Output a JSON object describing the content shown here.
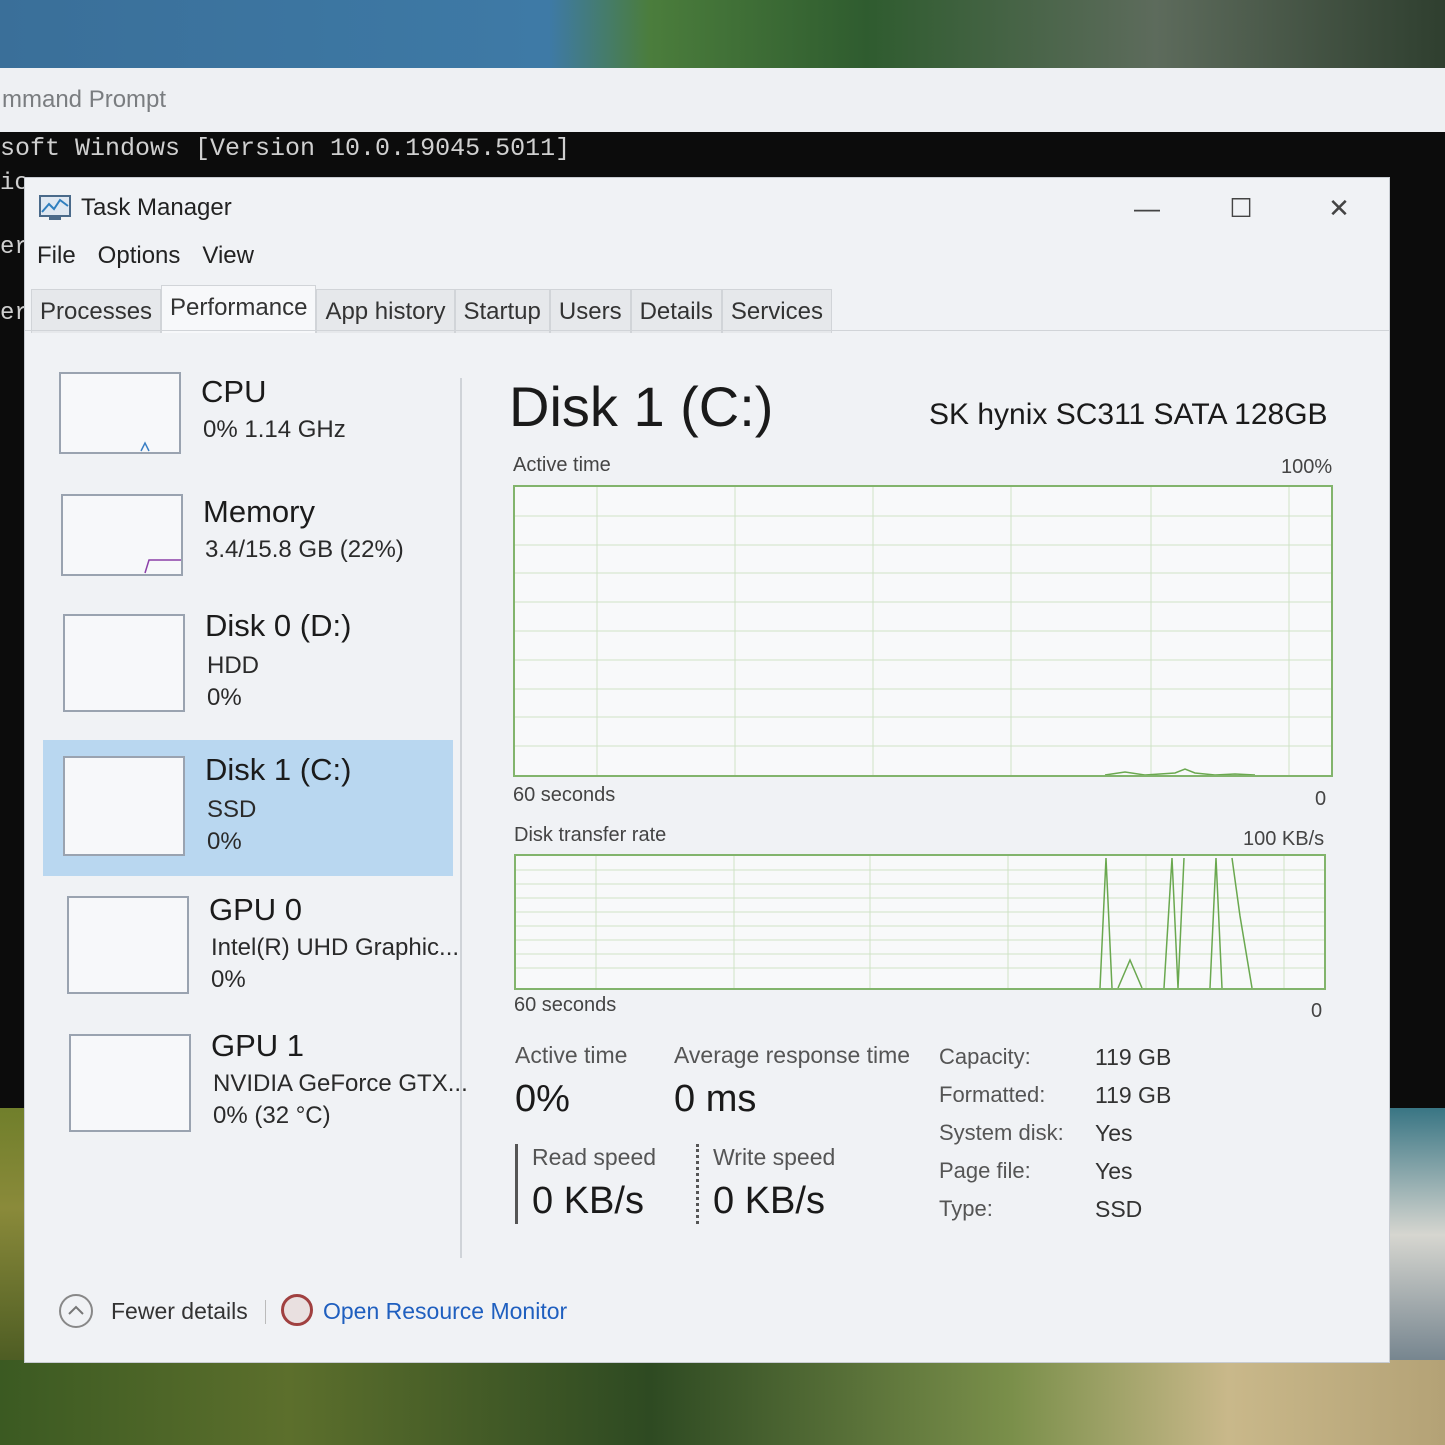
{
  "cmd": {
    "title": "mmand Prompt",
    "line1": "soft Windows [Version 10.0.19045.5011]",
    "frag1": "ic",
    "frag2": "er",
    "frag3": "er"
  },
  "window": {
    "title": "Task Manager",
    "minimize": "—",
    "maximize": "☐",
    "close": "✕"
  },
  "menu": [
    "File",
    "Options",
    "View"
  ],
  "tabs": [
    "Processes",
    "Performance",
    "App history",
    "Startup",
    "Users",
    "Details",
    "Services"
  ],
  "active_tab": "Performance",
  "sidebar": [
    {
      "name": "CPU",
      "sub1": "0%  1.14 GHz",
      "sub2": "",
      "sub3": ""
    },
    {
      "name": "Memory",
      "sub1": "3.4/15.8 GB (22%)",
      "sub2": "",
      "sub3": ""
    },
    {
      "name": "Disk 0 (D:)",
      "sub1": "HDD",
      "sub2": "0%",
      "sub3": ""
    },
    {
      "name": "Disk 1 (C:)",
      "sub1": "SSD",
      "sub2": "0%",
      "sub3": ""
    },
    {
      "name": "GPU 0",
      "sub1": "Intel(R) UHD Graphic...",
      "sub2": "0%",
      "sub3": ""
    },
    {
      "name": "GPU 1",
      "sub1": "NVIDIA GeForce GTX...",
      "sub2": "0%  (32 °C)",
      "sub3": ""
    }
  ],
  "selected_index": 3,
  "main": {
    "title": "Disk 1 (C:)",
    "device": "SK hynix SC311 SATA 128GB",
    "graph1": {
      "label": "Active time",
      "max": "100%",
      "time": "60 seconds",
      "min": "0"
    },
    "graph2": {
      "label": "Disk transfer rate",
      "max": "100 KB/s",
      "time": "60 seconds",
      "min": "0"
    }
  },
  "stats": {
    "active_time_label": "Active time",
    "active_time_value": "0%",
    "avg_resp_label": "Average response time",
    "avg_resp_value": "0 ms",
    "read_label": "Read speed",
    "read_value": "0 KB/s",
    "write_label": "Write speed",
    "write_value": "0 KB/s"
  },
  "info": [
    {
      "key": "Capacity:",
      "val": "119 GB"
    },
    {
      "key": "Formatted:",
      "val": "119 GB"
    },
    {
      "key": "System disk:",
      "val": "Yes"
    },
    {
      "key": "Page file:",
      "val": "Yes"
    },
    {
      "key": "Type:",
      "val": "SSD"
    }
  ],
  "footer": {
    "fewer": "Fewer details",
    "monitor": "Open Resource Monitor"
  },
  "colors": {
    "graph_border": "#82b46c",
    "selected_bg": "#b9d7f0",
    "link": "#1f5fbf"
  }
}
